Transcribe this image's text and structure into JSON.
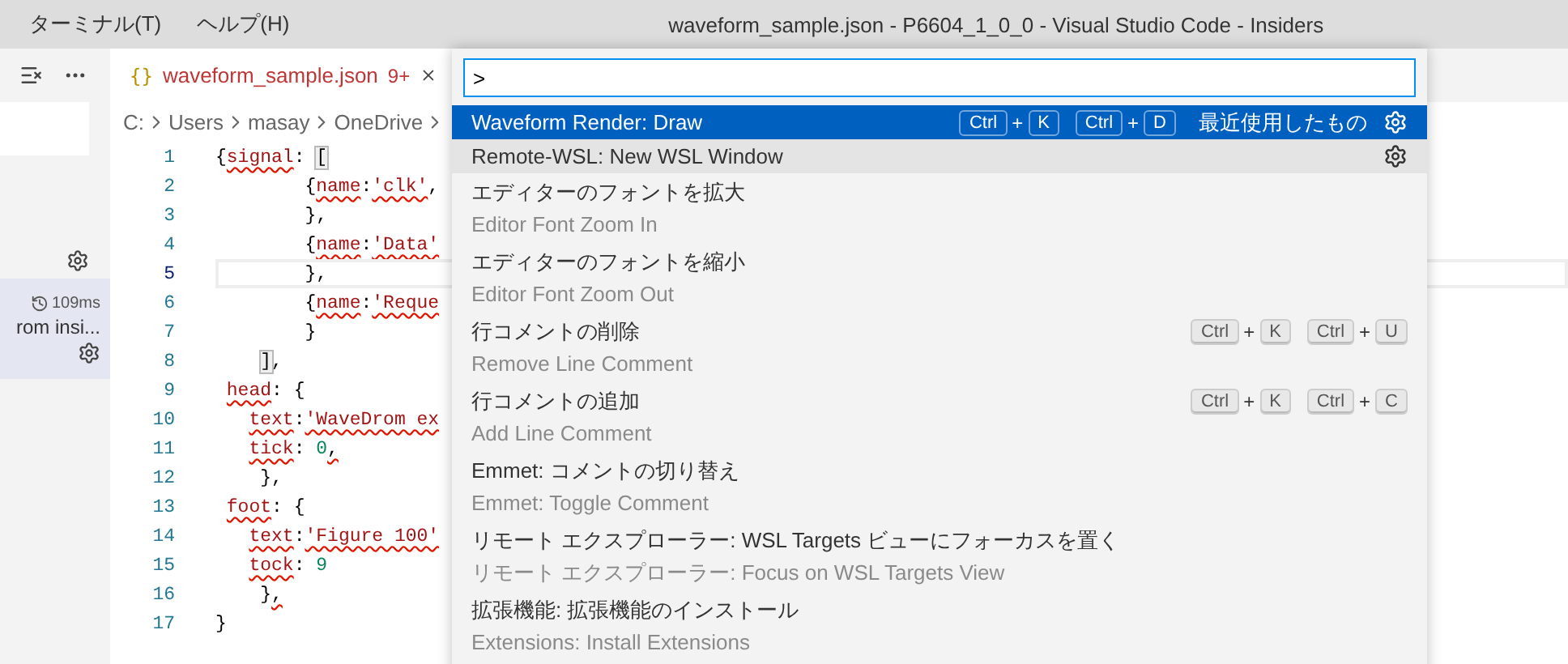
{
  "window": {
    "title": "waveform_sample.json - P6604_1_0_0 - Visual Studio Code - Insiders"
  },
  "menu": [
    "ターミナル(T)",
    "ヘルプ(H)"
  ],
  "sidebar": {
    "timing": "109ms",
    "item_text": "rom insi...",
    "item_selected": true
  },
  "tab": {
    "icon_text": "{}",
    "label": "waveform_sample.json",
    "badge": "9+",
    "active": true
  },
  "breadcrumbs": [
    "C:",
    "Users",
    "masay",
    "OneDrive"
  ],
  "code": [
    {
      "number": "1",
      "current": false,
      "tokens": [
        {
          "text": "{",
          "kind": "punct"
        },
        {
          "text": "signal",
          "kind": "key",
          "error": true
        },
        {
          "text": ": ",
          "kind": "punct"
        },
        {
          "text": "[",
          "kind": "bracket"
        }
      ]
    },
    {
      "number": "2",
      "current": false,
      "tokens": [
        {
          "text": "        {",
          "kind": "punct"
        },
        {
          "text": "name",
          "kind": "key",
          "error": true
        },
        {
          "text": ":",
          "kind": "punct"
        },
        {
          "text": "'clk'",
          "kind": "string",
          "error": true
        },
        {
          "text": ",",
          "kind": "punct"
        }
      ]
    },
    {
      "number": "3",
      "current": false,
      "tokens": [
        {
          "text": "        },",
          "kind": "punct"
        }
      ]
    },
    {
      "number": "4",
      "current": false,
      "tokens": [
        {
          "text": "        {",
          "kind": "punct"
        },
        {
          "text": "name",
          "kind": "key",
          "error": true
        },
        {
          "text": ":",
          "kind": "punct"
        },
        {
          "text": "'Data'",
          "kind": "string",
          "error": true
        }
      ]
    },
    {
      "number": "5",
      "current": true,
      "tokens": [
        {
          "text": "        },",
          "kind": "punct"
        }
      ]
    },
    {
      "number": "6",
      "current": false,
      "tokens": [
        {
          "text": "        {",
          "kind": "punct"
        },
        {
          "text": "name",
          "kind": "key",
          "error": true
        },
        {
          "text": ":",
          "kind": "punct"
        },
        {
          "text": "'Reque",
          "kind": "string",
          "error": true
        }
      ]
    },
    {
      "number": "7",
      "current": false,
      "tokens": [
        {
          "text": "        }",
          "kind": "punct"
        }
      ]
    },
    {
      "number": "8",
      "current": false,
      "tokens": [
        {
          "text": "    ]",
          "kind": "bracket"
        },
        {
          "text": ",",
          "kind": "punct"
        }
      ]
    },
    {
      "number": "9",
      "current": false,
      "tokens": [
        {
          "text": " head",
          "kind": "key",
          "error": true
        },
        {
          "text": ": {",
          "kind": "punct"
        }
      ]
    },
    {
      "number": "10",
      "current": false,
      "tokens": [
        {
          "text": "   text",
          "kind": "key",
          "error": true
        },
        {
          "text": ":",
          "kind": "punct"
        },
        {
          "text": "'WaveDrom ex",
          "kind": "string",
          "error": true
        }
      ]
    },
    {
      "number": "11",
      "current": false,
      "tokens": [
        {
          "text": "   tick",
          "kind": "key",
          "error": true
        },
        {
          "text": ": ",
          "kind": "punct"
        },
        {
          "text": "0",
          "kind": "number"
        },
        {
          "text": ",",
          "kind": "punct",
          "error": true
        }
      ]
    },
    {
      "number": "12",
      "current": false,
      "tokens": [
        {
          "text": "    },",
          "kind": "punct"
        }
      ]
    },
    {
      "number": "13",
      "current": false,
      "tokens": [
        {
          "text": " foot",
          "kind": "key",
          "error": true
        },
        {
          "text": ": {",
          "kind": "punct"
        }
      ]
    },
    {
      "number": "14",
      "current": false,
      "tokens": [
        {
          "text": "   text",
          "kind": "key",
          "error": true
        },
        {
          "text": ":",
          "kind": "punct"
        },
        {
          "text": "'Figure 100'",
          "kind": "string",
          "error": true
        }
      ]
    },
    {
      "number": "15",
      "current": false,
      "tokens": [
        {
          "text": "   tock",
          "kind": "key",
          "error": true
        },
        {
          "text": ": ",
          "kind": "punct"
        },
        {
          "text": "9",
          "kind": "number"
        }
      ]
    },
    {
      "number": "16",
      "current": false,
      "tokens": [
        {
          "text": "    }",
          "kind": "punct"
        },
        {
          "text": ",",
          "kind": "punct",
          "error": true
        }
      ]
    },
    {
      "number": "17",
      "current": false,
      "tokens": [
        {
          "text": "}",
          "kind": "punct"
        }
      ]
    }
  ],
  "palette": {
    "input": {
      "value": ">"
    },
    "items": [
      {
        "label": "Waveform Render: Draw",
        "selected": true,
        "hovered": false,
        "chords": [
          {
            "keys": [
              "Ctrl",
              "K"
            ],
            "joiner": "+"
          },
          {
            "keys": [
              "Ctrl",
              "D"
            ],
            "joiner": "+"
          }
        ],
        "recent": "最近使用したもの",
        "gear": true
      },
      {
        "label": "Remote-WSL: New WSL Window",
        "selected": false,
        "hovered": true,
        "gear": true
      },
      {
        "label": "エディターのフォントを拡大",
        "description": "Editor Font Zoom In",
        "selected": false,
        "hovered": false
      },
      {
        "label": "エディターのフォントを縮小",
        "description": "Editor Font Zoom Out",
        "selected": false,
        "hovered": false
      },
      {
        "label": "行コメントの削除",
        "description": "Remove Line Comment",
        "selected": false,
        "hovered": false,
        "chords": [
          {
            "keys": [
              "Ctrl",
              "K"
            ],
            "joiner": "+"
          },
          {
            "keys": [
              "Ctrl",
              "U"
            ],
            "joiner": "+"
          }
        ]
      },
      {
        "label": "行コメントの追加",
        "description": "Add Line Comment",
        "selected": false,
        "hovered": false,
        "chords": [
          {
            "keys": [
              "Ctrl",
              "K"
            ],
            "joiner": "+"
          },
          {
            "keys": [
              "Ctrl",
              "C"
            ],
            "joiner": "+"
          }
        ]
      },
      {
        "label": "Emmet: コメントの切り替え",
        "description": "Emmet: Toggle Comment",
        "selected": false,
        "hovered": false
      },
      {
        "label": "リモート エクスプローラー: WSL Targets ビューにフォーカスを置く",
        "description": "リモート エクスプローラー: Focus on WSL Targets View",
        "selected": false,
        "hovered": false
      },
      {
        "label": "拡張機能: 拡張機能のインストール",
        "description": "Extensions: Install Extensions",
        "selected": false,
        "hovered": false
      }
    ]
  }
}
